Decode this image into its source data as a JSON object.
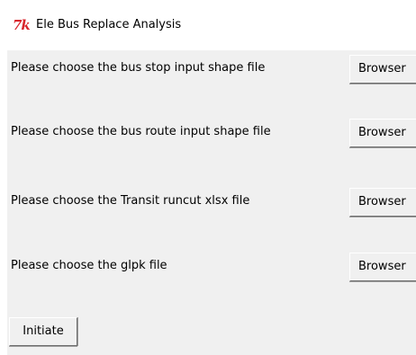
{
  "window": {
    "title": "Ele Bus Replace Analysis",
    "icon": "tk-feather-icon",
    "icon_text": "7k",
    "icon_color": "#d8262c"
  },
  "rows": [
    {
      "label": "Please choose the bus stop input shape file",
      "button": "Browser"
    },
    {
      "label": "Please choose the bus route input shape file",
      "button": "Browser"
    },
    {
      "label": "Please choose the Transit runcut xlsx file",
      "button": "Browser"
    },
    {
      "label": "Please choose the glpk file",
      "button": "Browser"
    }
  ],
  "actions": {
    "initiate_label": "Initiate"
  },
  "colors": {
    "client_background": "#f0f0f0",
    "titlebar_background": "#ffffff"
  }
}
